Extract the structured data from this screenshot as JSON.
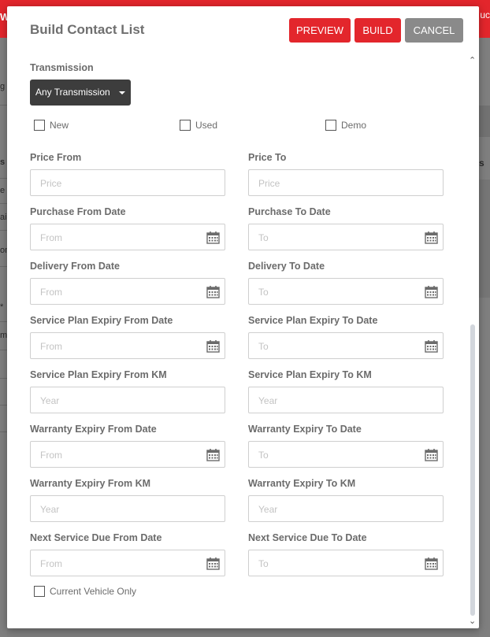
{
  "modal": {
    "title": "Build Contact List",
    "buttons": {
      "preview": "PREVIEW",
      "build": "BUILD",
      "cancel": "CANCEL"
    }
  },
  "transmission": {
    "label": "Transmission",
    "selected": "Any Transmission"
  },
  "condition_options": [
    "New",
    "Used",
    "Demo"
  ],
  "fields": {
    "price_from": {
      "label": "Price From",
      "placeholder": "Price"
    },
    "price_to": {
      "label": "Price To",
      "placeholder": "Price"
    },
    "purchase_from": {
      "label": "Purchase From Date",
      "placeholder": "From"
    },
    "purchase_to": {
      "label": "Purchase To Date",
      "placeholder": "To"
    },
    "delivery_from": {
      "label": "Delivery From Date",
      "placeholder": "From"
    },
    "delivery_to": {
      "label": "Delivery To Date",
      "placeholder": "To"
    },
    "sp_expiry_from_date": {
      "label": "Service Plan Expiry From Date",
      "placeholder": "From"
    },
    "sp_expiry_to_date": {
      "label": "Service Plan Expiry To Date",
      "placeholder": "To"
    },
    "sp_expiry_from_km": {
      "label": "Service Plan Expiry From KM",
      "placeholder": "Year"
    },
    "sp_expiry_to_km": {
      "label": "Service Plan Expiry To KM",
      "placeholder": "Year"
    },
    "warranty_from_date": {
      "label": "Warranty Expiry From Date",
      "placeholder": "From"
    },
    "warranty_to_date": {
      "label": "Warranty Expiry To Date",
      "placeholder": "To"
    },
    "warranty_from_km": {
      "label": "Warranty Expiry From KM",
      "placeholder": "Year"
    },
    "warranty_to_km": {
      "label": "Warranty Expiry To KM",
      "placeholder": "Year"
    },
    "next_service_from": {
      "label": "Next Service Due From Date",
      "placeholder": "From"
    },
    "next_service_to": {
      "label": "Next Service Due To Date",
      "placeholder": "To"
    }
  },
  "current_vehicle_only": "Current Vehicle Only",
  "icons": {
    "calendar": "calendar-icon",
    "caret": "caret-down-icon"
  },
  "colors": {
    "accent": "#e3262c",
    "cancel": "#8a8a8a",
    "dropdown": "#3d3d3d"
  }
}
